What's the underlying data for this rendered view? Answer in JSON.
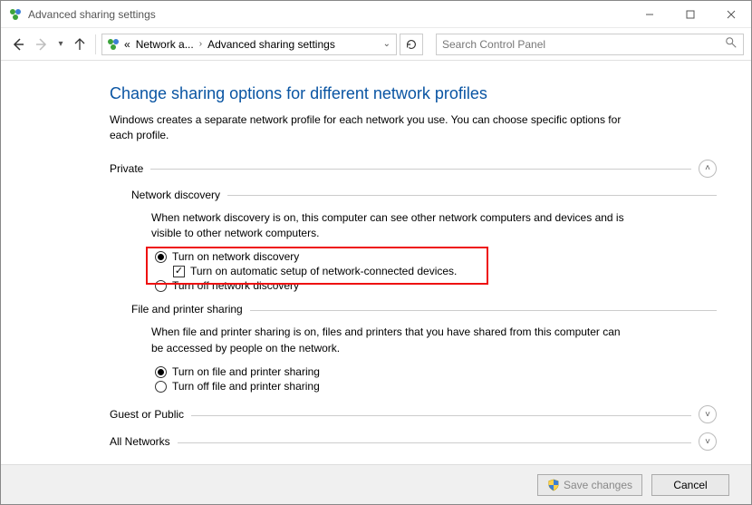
{
  "window": {
    "title": "Advanced sharing settings",
    "minimize_tooltip": "Minimize",
    "maximize_tooltip": "Maximize",
    "close_tooltip": "Close"
  },
  "nav": {
    "breadcrumb_overflow": "«",
    "crumb1": "Network a...",
    "crumb2": "Advanced sharing settings",
    "refresh_label": "Refresh"
  },
  "search": {
    "placeholder": "Search Control Panel"
  },
  "page": {
    "title": "Change sharing options for different network profiles",
    "desc": "Windows creates a separate network profile for each network you use. You can choose specific options for each profile."
  },
  "profiles": {
    "private": {
      "label": "Private"
    },
    "guest": {
      "label": "Guest or Public"
    },
    "all": {
      "label": "All Networks"
    }
  },
  "net_discovery": {
    "header": "Network discovery",
    "desc": "When network discovery is on, this computer can see other network computers and devices and is visible to other network computers.",
    "opt_on": "Turn on network discovery",
    "opt_auto": "Turn on automatic setup of network-connected devices.",
    "opt_off": "Turn off network discovery"
  },
  "file_printer": {
    "header": "File and printer sharing",
    "desc": "When file and printer sharing is on, files and printers that you have shared from this computer can be accessed by people on the network.",
    "opt_on": "Turn on file and printer sharing",
    "opt_off": "Turn off file and printer sharing"
  },
  "footer": {
    "save": "Save changes",
    "cancel": "Cancel"
  }
}
